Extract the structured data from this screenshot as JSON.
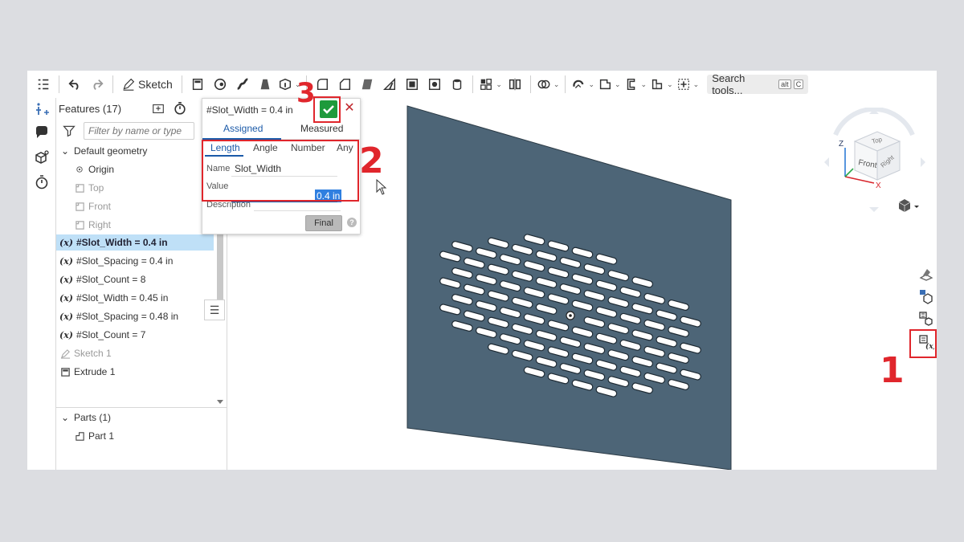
{
  "toolbar": {
    "sketch_label": "Sketch",
    "search_label": "Search tools...",
    "search_shortcut_1": "alt",
    "search_shortcut_2": "C"
  },
  "features": {
    "header": "Features (17)",
    "filter_placeholder": "Filter by name or type",
    "default_geometry_label": "Default geometry",
    "items": [
      {
        "label": "Origin"
      },
      {
        "label": "Top"
      },
      {
        "label": "Front"
      },
      {
        "label": "Right"
      }
    ],
    "variables": [
      {
        "label": "#Slot_Width = 0.4 in"
      },
      {
        "label": "#Slot_Spacing = 0.4 in"
      },
      {
        "label": "#Slot_Count = 8"
      },
      {
        "label": "#Slot_Width = 0.45 in"
      },
      {
        "label": "#Slot_Spacing = 0.48 in"
      },
      {
        "label": "#Slot_Count = 7"
      }
    ],
    "fx_symbol": "(x)",
    "sketch_label": "Sketch 1",
    "extrude_label": "Extrude 1",
    "parts_label": "Parts (1)",
    "part_label": "Part 1"
  },
  "dialog": {
    "title": "#Slot_Width = 0.4 in",
    "tabs": [
      "Assigned",
      "Measured"
    ],
    "subtabs": [
      "Length",
      "Angle",
      "Number",
      "Any"
    ],
    "name_label": "Name",
    "name_value": "Slot_Width",
    "value_label": "Value",
    "value_value": "0.4 in",
    "description_label": "Description",
    "final_label": "Final",
    "help_label": "?",
    "cancel_label": "✕"
  },
  "viewcube": {
    "top": "Top",
    "front": "Front",
    "right": "Right",
    "axis_x": "X",
    "axis_z": "Z"
  },
  "annotations": {
    "step1": "1",
    "step2": "2",
    "step3": "3"
  },
  "colors": {
    "plate": "#4d6577",
    "accent": "#1b5aa8",
    "highlight": "#e0262c",
    "ok_green": "#1e9a3c"
  }
}
